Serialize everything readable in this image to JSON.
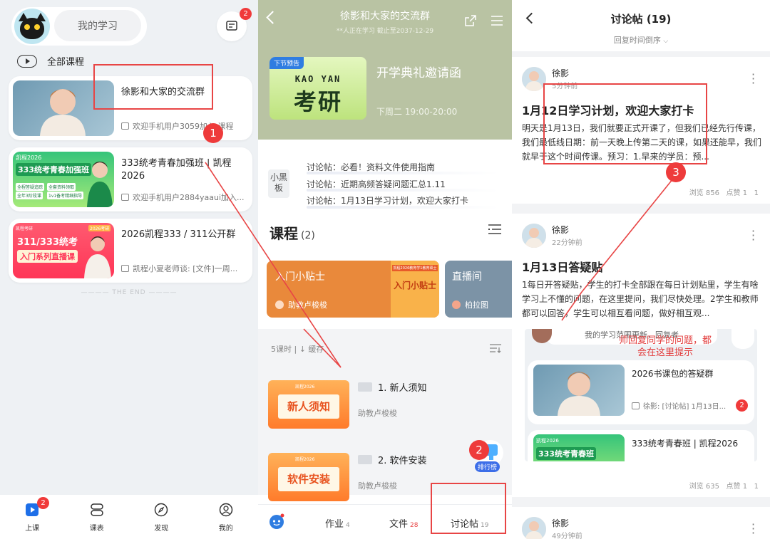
{
  "panel1": {
    "search_label": "我的学习",
    "msg_badge": "2",
    "all_courses": "全部课程",
    "groups": [
      {
        "title": "徐影和大家的交流群",
        "last_msg": "欢迎手机用户3059加入 课程"
      },
      {
        "title": "333统考青春加强班 | 凯程2026",
        "last_msg": "欢迎手机用户2884yaaui加入...",
        "thumb_top": "凯程2026",
        "thumb_main": "333统考青春加强班",
        "thumb_pills": [
          "全程答疑追踪",
          "全套资料领取",
          "全年3阶段课",
          "1v1备考精细指导"
        ]
      },
      {
        "title": "2026凯程333 / 311公开群",
        "last_msg": "凯程小夏老师谈: [文件]一周...",
        "thumb_top": "2026考研",
        "thumb_brand": "凯程考研",
        "thumb_main1": "311/333统考",
        "thumb_main2": "入门系列直播课"
      }
    ],
    "the_end": "THE END",
    "tabs": [
      {
        "label": "上课",
        "badge": "2",
        "icon": "play-square-icon"
      },
      {
        "label": "课表",
        "icon": "schedule-icon"
      },
      {
        "label": "发现",
        "icon": "compass-icon"
      },
      {
        "label": "我的",
        "icon": "user-icon"
      }
    ]
  },
  "panel2": {
    "title": "徐影和大家的交流群",
    "subtitle": "**人正在学习 截止至2037-12-29",
    "live_tag": "下节预告",
    "live_en": "KAO YAN",
    "live_cn": "考研",
    "live_name": "开学典礼邀请函",
    "live_time": "下周二 19:00-20:00",
    "blackboard_label": "小黑板",
    "blackboard_items": [
      "讨论帖：必看！资料文件使用指南",
      "讨论帖：近期高频答疑问题汇总1.11",
      "讨论帖：1月13日学习计划，欢迎大家打卡"
    ],
    "course_heading": "课程",
    "course_count": "(2)",
    "tip_title": "入门小贴士",
    "tip_teacher": "助教卢梭梭",
    "tip_thumb_top": "凯程2026教育学1教育硕士",
    "tip_thumb_main": "入门小贴士",
    "livehall_title": "直播间",
    "livehall_teacher": "柏拉图",
    "lesson_meta": "5课时 | ↓ 缓存",
    "lessons": [
      {
        "thumb_top": "凯程2026",
        "thumb_text": "新人须知",
        "title": "1. 新人须知",
        "teacher": "助教卢梭梭"
      },
      {
        "thumb_top": "凯程2026",
        "thumb_text": "软件安装",
        "title": "2. 软件安装",
        "teacher": "助教卢梭梭"
      }
    ],
    "rank_label": "排行榜",
    "bottom": {
      "homework": "作业",
      "homework_count": "4",
      "files": "文件",
      "files_count": "28",
      "discussion": "讨论帖",
      "discussion_count": "19"
    }
  },
  "panel3": {
    "title": "讨论帖 (19)",
    "sort": "回复时间倒序",
    "posts": [
      {
        "author": "徐影",
        "time": "5分钟前",
        "title": "1月12日学习计划，欢迎大家打卡",
        "body": "明天是1月13日，我们就要正式开课了，但我们已经先行传课，我们最低线日期：前一天晚上传第二天的课，如果还能早，我们就早于这个时间传课。预习：1.早来的学员：预...",
        "views": "浏览 856",
        "likes": "点赞 1",
        "comments": "1"
      },
      {
        "author": "徐影",
        "time": "22分钟前",
        "title": "1月13日答疑贴",
        "body": "1每日开答疑贴，学生的打卡全部跟在每日计划贴里，学生有啥学习上不懂的问题，在这里提问，我们尽快处理。2学生和教师都可以回答，学生可以相互看问题，做好相互观...",
        "views": "浏览 635",
        "likes": "点赞 1",
        "comments": "1"
      },
      {
        "author": "徐影",
        "time": "49分钟前"
      }
    ],
    "embed_top_text": "我的学习范围更新，回复者",
    "annotation": "师回复同学的问题，都会在这里提示",
    "embed_cards": [
      {
        "title": "2026书课包的答疑群",
        "msg": "徐影: [讨论帖] 1月13日...",
        "badge": "2"
      },
      {
        "title": "333统考青春班 | 凯程2026",
        "thumb_top": "凯程2026",
        "thumb_main": "333统考青春班"
      }
    ]
  },
  "steps": [
    "1",
    "2",
    "3"
  ]
}
